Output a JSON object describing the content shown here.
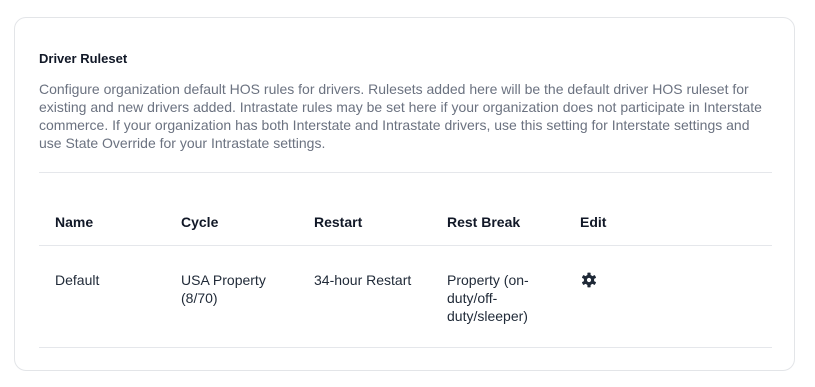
{
  "section": {
    "title": "Driver Ruleset",
    "description": "Configure organization default HOS rules for drivers. Rulesets added here will be the default driver HOS ruleset for existing and new drivers added. Intrastate rules may be set here if your organization does not participate in Interstate commerce. If your organization has both Interstate and Intrastate drivers, use this setting for Interstate settings and use State Override for your Intrastate settings."
  },
  "table": {
    "headers": {
      "name": "Name",
      "cycle": "Cycle",
      "restart": "Restart",
      "rest_break": "Rest Break",
      "edit": "Edit"
    },
    "rows": [
      {
        "name": "Default",
        "cycle_line1": "USA Property",
        "cycle_line2": "(8/70)",
        "restart": "34-hour Restart",
        "rest_break_line1": "Property (on-",
        "rest_break_line2": "duty/off-",
        "rest_break_line3": "duty/sleeper)",
        "edit_icon": "gear-icon"
      }
    ]
  }
}
